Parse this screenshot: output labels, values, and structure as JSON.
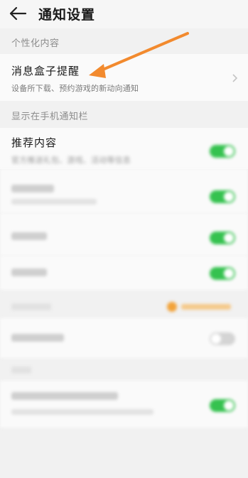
{
  "header": {
    "title": "通知设置",
    "back_icon": "arrow-left-icon"
  },
  "sections": {
    "personal": {
      "label": "个性化内容"
    },
    "status_bar": {
      "label": "显示在手机通知栏"
    }
  },
  "message_box": {
    "title": "消息盒子提醒",
    "subtitle": "设备所下载、预约游戏的新动向通知",
    "chevron_icon": "chevron-right-icon"
  },
  "recommend": {
    "title": "推荐内容",
    "subtitle": "官方推送礼包、游戏、活动等信息",
    "enabled": true
  },
  "blurred_items": [
    {
      "enabled": true
    },
    {
      "enabled": true
    },
    {
      "enabled": true
    },
    {
      "enabled": false
    },
    {
      "enabled": true
    }
  ],
  "colors": {
    "toggle_on": "#35c24f",
    "annotation_arrow": "#f28a2e",
    "badge": "#f2a33a"
  }
}
